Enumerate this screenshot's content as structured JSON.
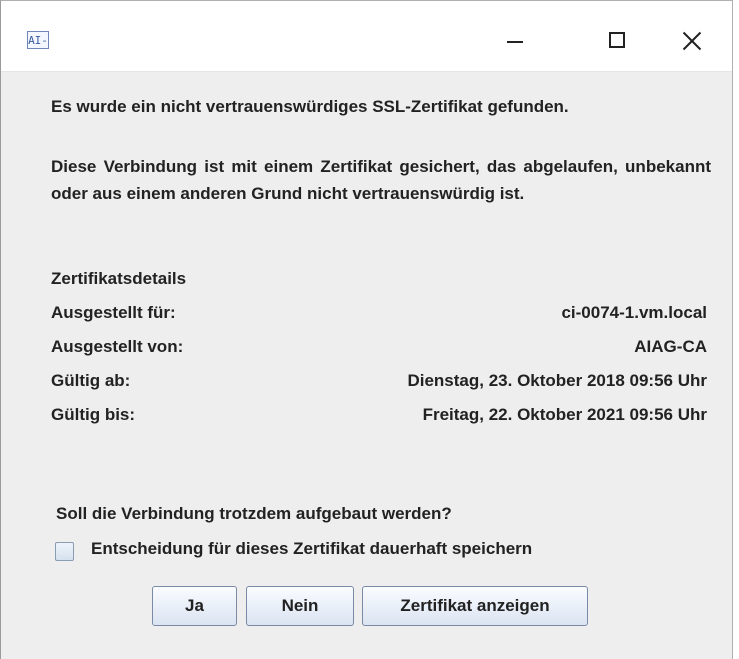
{
  "titlebar": {
    "icon_text": "AI-",
    "icon_name": "java-app-icon",
    "title": ""
  },
  "message": {
    "line1": "Es wurde ein nicht vertrauenswürdiges SSL-Zertifikat gefunden.",
    "paragraph": "Diese Verbindung ist mit einem Zertifikat gesichert, das abgelaufen, unbekannt oder aus einem anderen Grund nicht vertrauenswürdig ist."
  },
  "details": {
    "title": "Zertifikatsdetails",
    "rows": [
      {
        "label": "Ausgestellt für:",
        "value": "ci-0074-1.vm.local"
      },
      {
        "label": "Ausgestellt von:",
        "value": "AIAG-CA"
      },
      {
        "label": "Gültig ab:",
        "value": "Dienstag, 23. Oktober 2018 09:56 Uhr"
      },
      {
        "label": "Gültig bis:",
        "value": "Freitag, 22. Oktober 2021 09:56 Uhr"
      }
    ]
  },
  "prompt": {
    "question": "Soll die Verbindung trotzdem aufgebaut werden?",
    "checkbox_label": "Entscheidung für dieses Zertifikat dauerhaft speichern",
    "checkbox_checked": false
  },
  "buttons": {
    "yes": "Ja",
    "no": "Nein",
    "show_certificate": "Zertifikat anzeigen"
  },
  "colors": {
    "window_bg": "#eeeeee",
    "titlebar_bg": "#ffffff",
    "text": "#222222",
    "button_border": "#7a8aa6"
  }
}
